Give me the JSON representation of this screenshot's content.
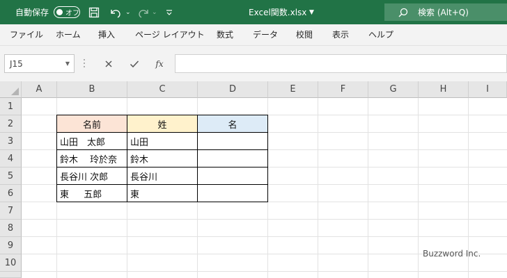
{
  "titlebar": {
    "autosave_label": "自動保存",
    "autosave_state": "オフ",
    "filename": "Excel関数.xlsx",
    "search_label": "検索 (Alt+Q)",
    "bg_color": "#217346"
  },
  "menu": [
    "ファイル",
    "ホーム",
    "挿入",
    "ページ レイアウト",
    "数式",
    "データ",
    "校閲",
    "表示",
    "ヘルプ"
  ],
  "formula_bar": {
    "name_box": "J15",
    "fx_label": "fx",
    "formula": ""
  },
  "grid": {
    "columns": [
      "A",
      "B",
      "C",
      "D",
      "E",
      "F",
      "G",
      "H",
      "I"
    ],
    "rows": [
      "1",
      "2",
      "3",
      "4",
      "5",
      "6",
      "7",
      "8",
      "9",
      "10"
    ],
    "table": {
      "headers": [
        "名前",
        "姓",
        "名"
      ],
      "header_colors": [
        "#fce4d6",
        "#fff2cc",
        "#ddebf7"
      ],
      "rows": [
        [
          "山田　太郎",
          "山田",
          ""
        ],
        [
          "鈴木　 玲於奈",
          "鈴木",
          ""
        ],
        [
          "長谷川 次郎",
          "長谷川",
          ""
        ],
        [
          "東　  五郎",
          "東",
          ""
        ]
      ]
    }
  },
  "watermark": "Buzzword Inc."
}
